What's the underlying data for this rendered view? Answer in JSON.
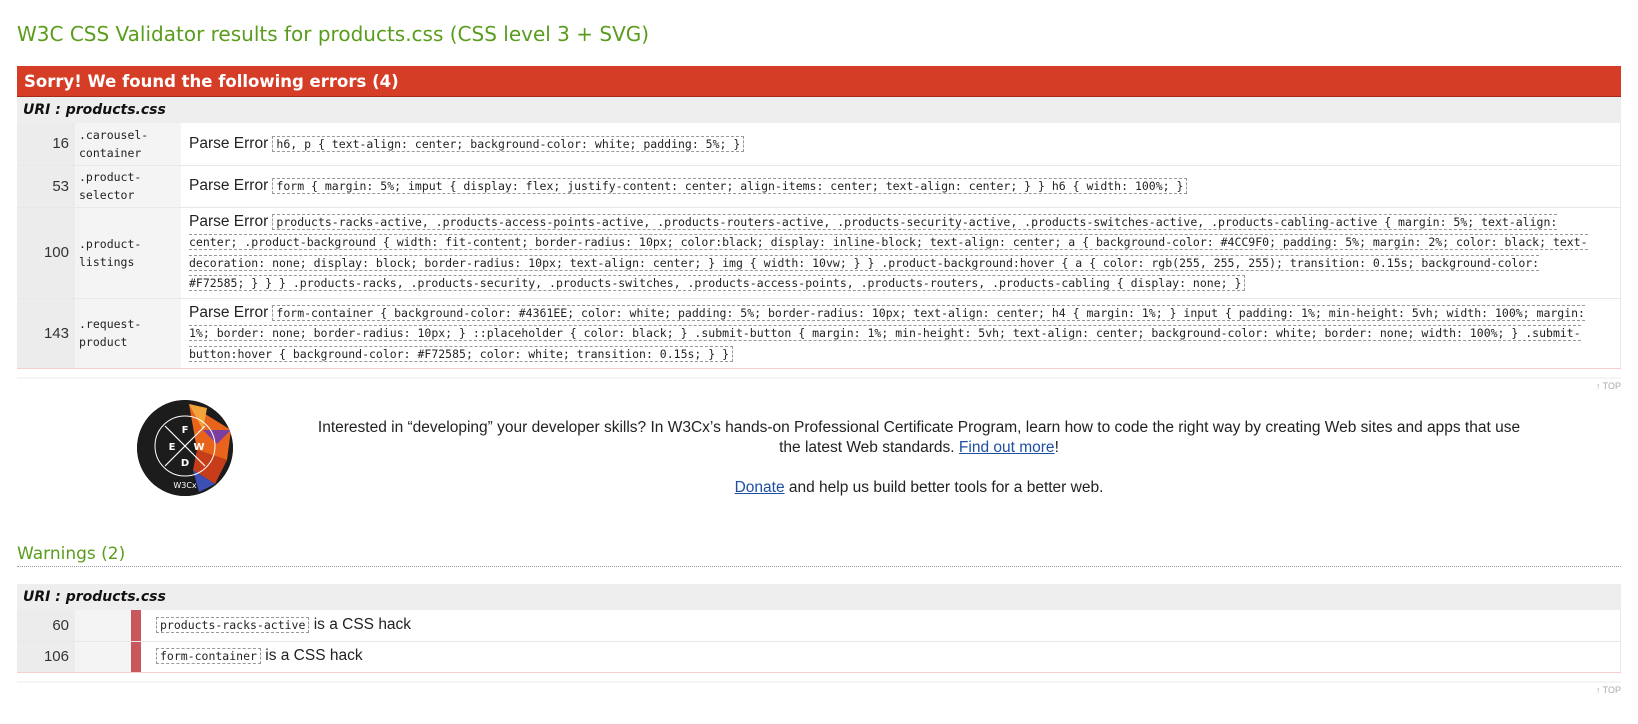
{
  "page_title": "W3C CSS Validator results for products.css (CSS level 3 + SVG)",
  "errors": {
    "heading": "Sorry! We found the following errors (4)",
    "uri": "URI : products.css",
    "rows": [
      {
        "line": "16",
        "context_a": ".carousel-",
        "context_b": "container",
        "type": "Parse Error",
        "snippet": "h6, p { text-align: center; background-color: white; padding: 5%; }"
      },
      {
        "line": "53",
        "context_a": ".product-",
        "context_b": "selector",
        "type": "Parse Error",
        "snippet": "form { margin: 5%; imput { display: flex; justify-content: center; align-items: center; text-align: center; } } h6 { width: 100%; }"
      },
      {
        "line": "100",
        "context_a": ".product-",
        "context_b": "listings",
        "type": "Parse Error",
        "snippet": "products-racks-active, .products-access-points-active, .products-routers-active, .products-security-active, .products-switches-active, .products-cabling-active { margin: 5%; text-align: center; .product-background { width: fit-content; border-radius: 10px; color:black; display: inline-block; text-align: center; a { background-color: #4CC9F0; padding: 5%; margin: 2%; color: black; text-decoration: none; display: block; border-radius: 10px; text-align: center; } img { width: 10vw; } } .product-background:hover { a { color: rgb(255, 255, 255); transition: 0.15s; background-color: #F72585; } } } .products-racks, .products-security, .products-switches, .products-access-points, .products-routers, .products-cabling { display: none; }"
      },
      {
        "line": "143",
        "context_a": ".request-",
        "context_b": "product",
        "type": "Parse Error",
        "snippet": "form-container { background-color: #4361EE; color: white; padding: 5%; border-radius: 10px; text-align: center; h4 { margin: 1%; } input { padding: 1%; min-height: 5vh; width: 100%; margin: 1%; border: none; border-radius: 10px; } ::placeholder { color: black; } .submit-button { margin: 1%; min-height: 5vh; text-align: center; background-color: white; border: none; width: 100%; } .submit-button:hover { background-color: #F72585; color: white; transition: 0.15s; } }"
      }
    ]
  },
  "top_link": "↑ TOP",
  "promo": {
    "logo_text": "FRONT END WEB DEVELOPER",
    "logo_brand": "W3Cx",
    "logo_letters": [
      "F",
      "E",
      "W",
      "D"
    ],
    "text_pre": "Interested in “developing” your developer skills? In W3Cx’s hands-on Professional Certificate Program, learn how to code the right way by creating Web sites and apps that use the latest Web standards. ",
    "find_out_more": "Find out more",
    "text_post": "!",
    "donate": "Donate",
    "donate_post": " and help us build better tools for a better web."
  },
  "warnings": {
    "heading": "Warnings (2)",
    "uri": "URI : products.css",
    "rows": [
      {
        "line": "60",
        "snippet": "products-racks-active",
        "message": " is a CSS hack"
      },
      {
        "line": "106",
        "snippet": "form-container",
        "message": " is a CSS hack"
      }
    ]
  },
  "colors": {
    "title_green": "#5a9c1c",
    "error_red": "#d53d26",
    "warning_bar": "#c9585c",
    "link_blue": "#1e4fa3"
  }
}
